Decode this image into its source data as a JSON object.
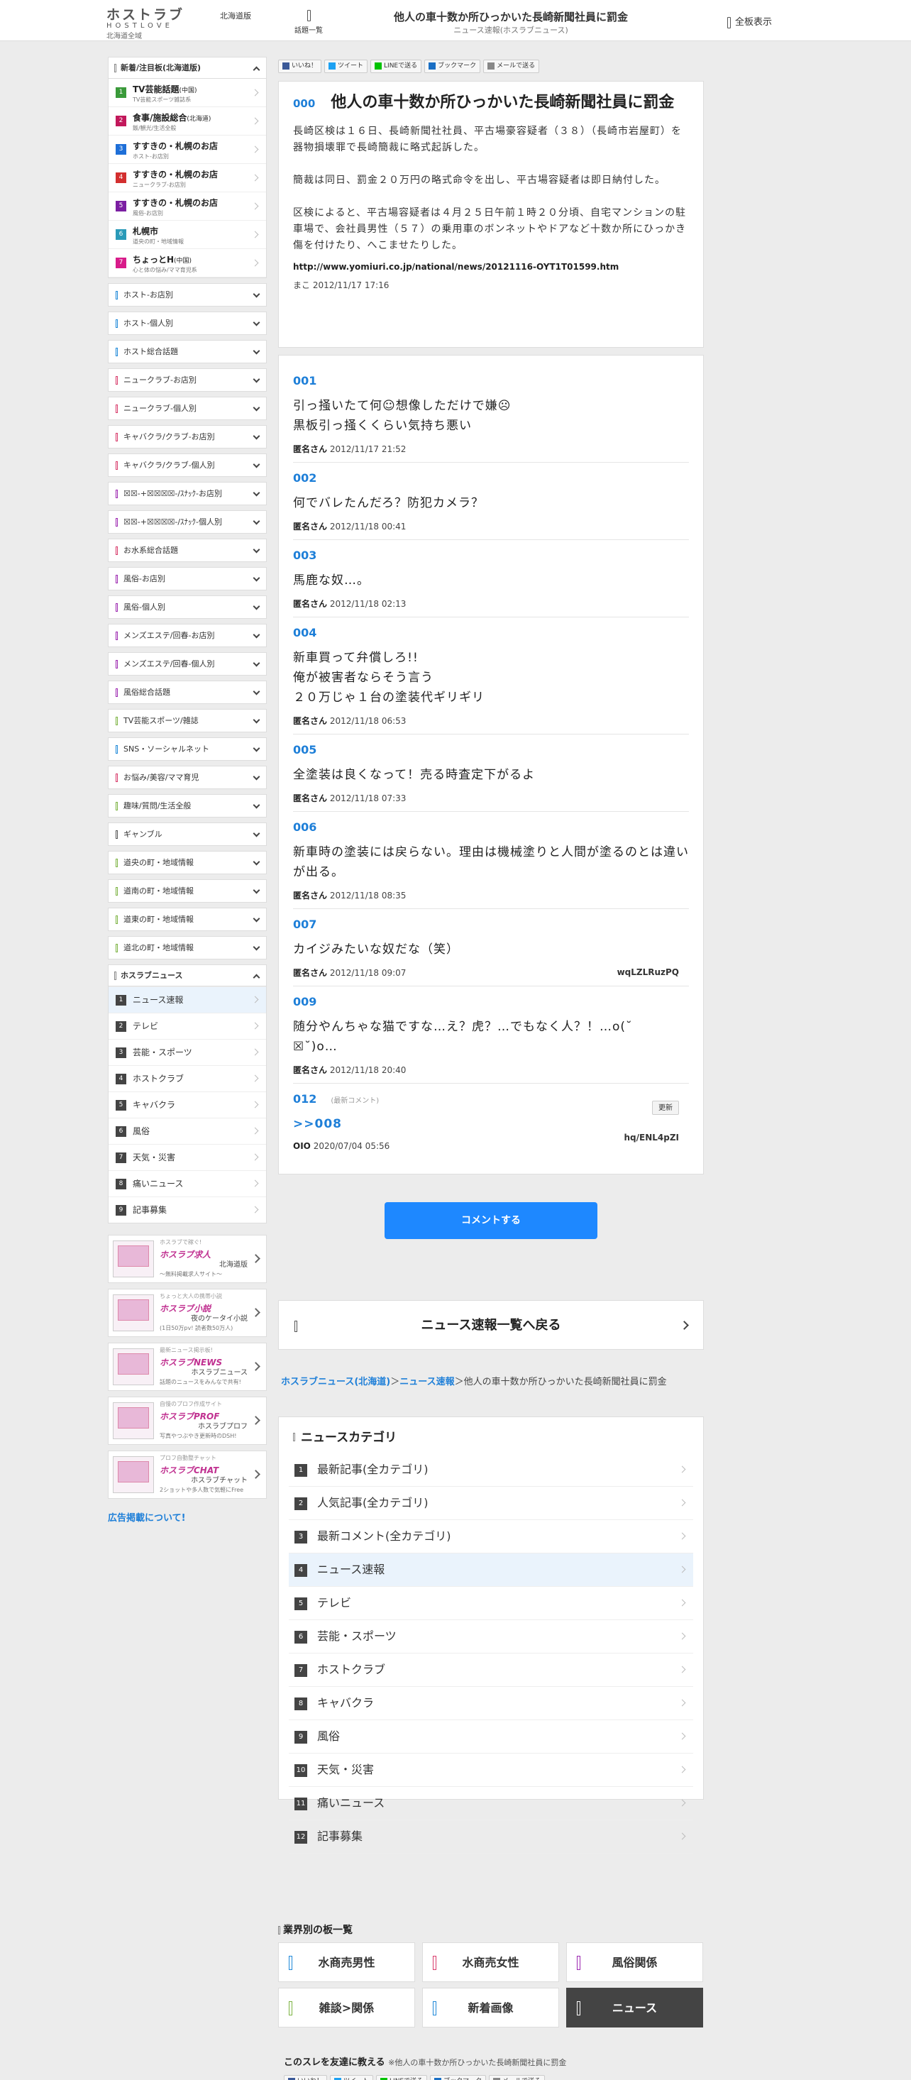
{
  "header": {
    "logo_jp": "ホストラブ",
    "logo_en": "HOSTLOVE",
    "logo_sub": "北海道全域",
    "region": "北海道版",
    "menu_label": "話題一覧",
    "title": "他人の車十数か所ひっかいた長崎新聞社員に罰金",
    "subtitle": "ニュース速報(ホスラブニュース)",
    "all_boards": "全板表示"
  },
  "sidebar": {
    "featured_head": "新着/注目板(北海道版)",
    "featured": [
      {
        "num": "1",
        "color": "#3a9a3a",
        "title": "TV芸能話題",
        "tag": "(中国)",
        "sub": "TV芸能スポーツ雑誌系"
      },
      {
        "num": "2",
        "color": "#c2185b",
        "title": "食事/施設総合",
        "tag": "(北海道)",
        "sub": "飯/観光/生活全般"
      },
      {
        "num": "3",
        "color": "#1e6fd8",
        "title": "すすきの・札幌のお店",
        "tag": "",
        "sub": "ホスト-お店別"
      },
      {
        "num": "4",
        "color": "#d32f2f",
        "title": "すすきの・札幌のお店",
        "tag": "",
        "sub": "ニュークラブ-お店別"
      },
      {
        "num": "5",
        "color": "#7b1fa2",
        "title": "すすきの・札幌のお店",
        "tag": "",
        "sub": "風俗-お店別"
      },
      {
        "num": "6",
        "color": "#2a9ab8",
        "title": "札幌市",
        "tag": "",
        "sub": "道央の町・地域情報"
      },
      {
        "num": "7",
        "color": "#d81b8a",
        "title": "ちょっとH",
        "tag": "(中国)",
        "sub": "心と体の悩み/ママ育児系"
      }
    ],
    "categories": [
      "ホスト-お店別",
      "ホスト-個人別",
      "ホスト総合話題",
      "ニュークラブ-お店別",
      "ニュークラブ-個人別",
      "キャバクラ/クラブ-お店別",
      "キャバクラ/クラブ-個人別",
      "☒☒-+☒☒☒☒-/ｽﾅｯｸ-お店別",
      "☒☒-+☒☒☒☒-/ｽﾅｯｸ-個人別",
      "お水系総合話題",
      "風俗-お店別",
      "風俗-個人別",
      "メンズエステ/回春-お店別",
      "メンズエステ/回春-個人別",
      "風俗総合話題",
      "TV芸能スポーツ/雑誌",
      "SNS・ソーシャルネット",
      "お悩み/美容/ママ育児",
      "趣味/質問/生活全般",
      "ギャンブル",
      "道央の町・地域情報",
      "道南の町・地域情報",
      "道東の町・地域情報",
      "道北の町・地域情報"
    ],
    "news_head": "ホスラブニュース",
    "news": [
      "ニュース速報",
      "テレビ",
      "芸能・スポーツ",
      "ホストクラブ",
      "キャバクラ",
      "風俗",
      "天気・災害",
      "痛いニュース",
      "記事募集"
    ],
    "banners": [
      {
        "tag": "ホスラブで稼ぐ!",
        "title": "ホスラブ求人",
        "sub1": "北海道版",
        "sub2": "〜無料掲載求人サイト〜"
      },
      {
        "tag": "ちょっと大人の携帯小説",
        "title": "ホスラブ小説",
        "sub1": "夜のケータイ小説",
        "sub2": "(1日50万pv! 読者数50万人)"
      },
      {
        "tag": "最新ニュース掲示板!",
        "title": "ホスラブNEWS",
        "sub1": "ホスラブニュース",
        "sub2": "話題のニュースをみんなで共有!"
      },
      {
        "tag": "自慢のプロフ作成サイト",
        "title": "ホスラブPROF",
        "sub1": "ホスラブプロフ",
        "sub2": "写真やつぶやき更新時のDSH!"
      },
      {
        "tag": "プロフ自動整チャット",
        "title": "ホスラブCHAT",
        "sub1": "ホスラブチャット",
        "sub2": "2ショットや多人数で気軽にFree"
      }
    ],
    "ad_link": "広告掲載について!"
  },
  "share": [
    "いいね！",
    "ツイート",
    "LINEで送る",
    "ブックマーク",
    "メールで送る"
  ],
  "op": {
    "num": "000",
    "title": "他人の車十数か所ひっかいた長崎新聞社員に罰金",
    "p1": "長崎区検は１６日、長崎新聞社社員、平古場豪容疑者（３８）（長崎市岩屋町）を器物損壊罪で長崎簡裁に略式起訴した。",
    "p2": "簡裁は同日、罰金２０万円の略式命令を出し、平古場容疑者は即日納付した。",
    "p3": "区検によると、平古場容疑者は４月２５日午前１時２０分頃、自宅マンションの駐車場で、会社員男性（５７）の乗用車のボンネットやドアなど十数か所にひっかき傷を付けたり、へこませたりした。",
    "url": "http://www.yomiuri.co.jp/national/news/20121116-OYT1T01599.htm",
    "name": "まこ",
    "date": "2012/11/17 17:16"
  },
  "responses": [
    {
      "num": "001",
      "text": "引っ掻いたて何☺想像しただけで嫌☹\n黒板引っ掻くくらい気持ち悪い",
      "name": "匿名さん",
      "date": "2012/11/17 21:52",
      "id": ""
    },
    {
      "num": "002",
      "text": "何でバレたんだろ？防犯カメラ？",
      "name": "匿名さん",
      "date": "2012/11/18 00:41",
      "id": ""
    },
    {
      "num": "003",
      "text": "馬鹿な奴…。",
      "name": "匿名さん",
      "date": "2012/11/18 02:13",
      "id": ""
    },
    {
      "num": "004",
      "text": "新車買って弁償しろ!!\n俺が被害者ならそう言う\n２０万じゃ１台の塗装代ギリギリ",
      "name": "匿名さん",
      "date": "2012/11/18 06:53",
      "id": ""
    },
    {
      "num": "005",
      "text": "全塗装は良くなって！売る時査定下がるよ",
      "name": "匿名さん",
      "date": "2012/11/18 07:33",
      "id": ""
    },
    {
      "num": "006",
      "text": "新車時の塗装には戻らない。理由は機械塗りと人間が塗るのとは違いが出る。",
      "name": "匿名さん",
      "date": "2012/11/18 08:35",
      "id": ""
    },
    {
      "num": "007",
      "text": "カイジみたいな奴だな（笑）",
      "name": "匿名さん",
      "date": "2012/11/18 09:07",
      "id": "wqLZLRuzPQ"
    },
    {
      "num": "009",
      "text": "随分やんちゃな猫ですな…え？虎？…でもなく人？！…o(˘\n☒˘)o…",
      "name": "匿名さん",
      "date": "2012/11/18 20:40",
      "id": ""
    }
  ],
  "latest": {
    "num": "012",
    "label": "(最新コメント)",
    "update": "更新",
    "anchor": ">>008",
    "name": "OIO",
    "date": "2020/07/04 05:56",
    "id": "hq/ENL4pZI"
  },
  "comment_button": "コメントする",
  "back_button": "ニュース速報一覧へ戻る",
  "breadcrumb": {
    "a1": "ホスラブニュース(北海道)",
    "a2": "ニュース速報",
    "current": "他人の車十数か所ひっかいた長崎新聞社員に罰金"
  },
  "news_categories": {
    "head": "ニュースカテゴリ",
    "items": [
      "最新記事(全カテゴリ)",
      "人気記事(全カテゴリ)",
      "最新コメント(全カテゴリ)",
      "ニュース速報",
      "テレビ",
      "芸能・スポーツ",
      "ホストクラブ",
      "キャバクラ",
      "風俗",
      "天気・災害",
      "痛いニュース",
      "記事募集"
    ]
  },
  "boards": {
    "head": "業界別の板一覧",
    "items": [
      "水商売男性",
      "水商売女性",
      "風俗関係",
      "雑談>関係",
      "新着画像",
      "ニュース"
    ],
    "colors": [
      "#1e88d8",
      "#d83a6a",
      "#9c27b0",
      "#7cb342",
      "#1e88d8",
      "#ffffff"
    ]
  },
  "footer_share": {
    "head": "このスレを友達に教える",
    "note": "※他人の車十数か所ひっかいた長崎新聞社員に罰金"
  }
}
